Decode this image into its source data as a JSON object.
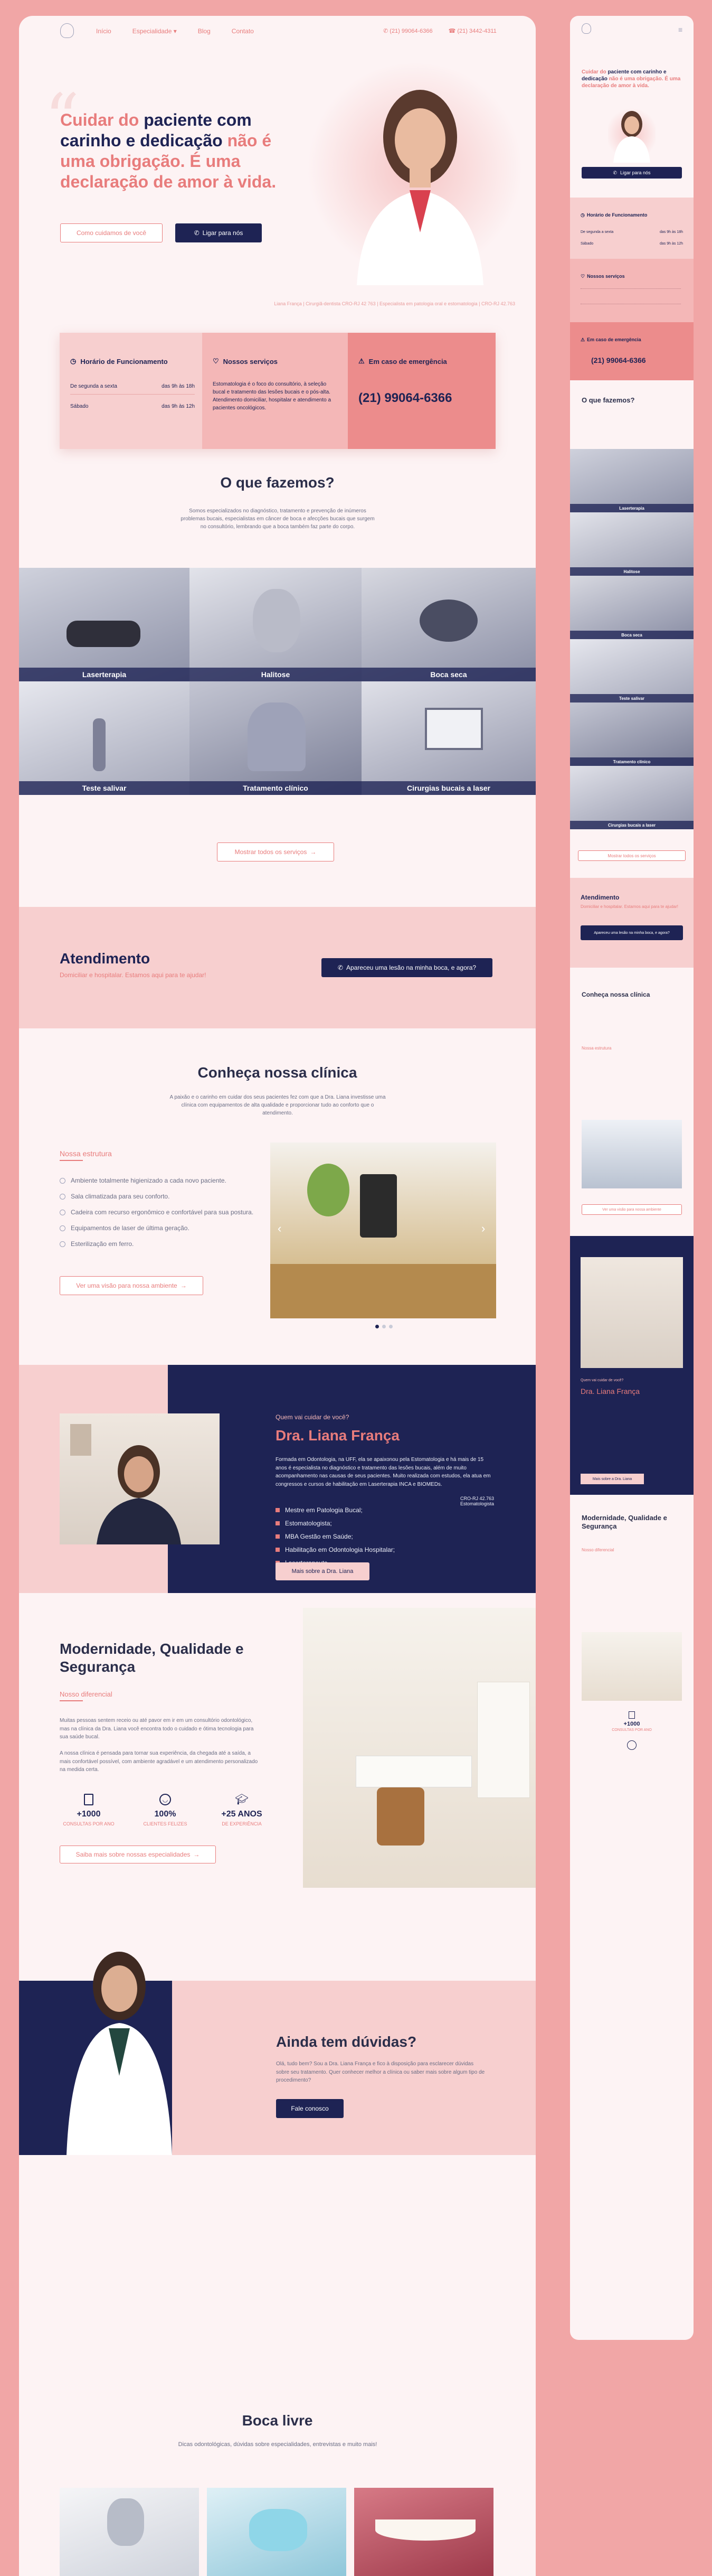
{
  "nav": {
    "links": [
      "Início",
      "Especialidade",
      "Blog",
      "Contato"
    ],
    "phone1": "(21) 99064-6366",
    "phone2": "(21) 3442-4311"
  },
  "hero": {
    "title_1": "Cuidar do ",
    "title_2": "paciente com carinho e dedicação",
    "title_3": " não é uma obrigação. É uma declaração de amor à vida.",
    "btn_outline": "Como cuidamos de você",
    "btn_primary": "Ligar para nós",
    "caption": "Liana França | Cirurgiã-dentista CRO-RJ 42 763 | Especialista em patologia oral e estomatologia | CRO-RJ 42.763"
  },
  "info": {
    "hours_title": "Horário de Funcionamento",
    "hours": [
      {
        "day": "De segunda a sexta",
        "time": "das 9h às 18h"
      },
      {
        "day": "Sábado",
        "time": "das 9h às 12h"
      }
    ],
    "services_title": "Nossos serviços",
    "services_text": "Estomatologia é o foco do consultório, à seleção bucal e tratamento das lesões bucais e o pós-alta. Atendimento domiciliar, hospitalar e atendimento a pacientes oncológicos.",
    "emergency_title": "Em caso de emergência",
    "emergency_phone": "(21) 99064-6366"
  },
  "what": {
    "title": "O que fazemos?",
    "text": "Somos especializados no diagnóstico, tratamento e prevenção de inúmeros problemas bucais, especialistas em câncer de boca e afecções bucais que surgem no consultório, lembrando que a boca também faz parte do corpo.",
    "services": [
      "Laserterapia",
      "Halitose",
      "Boca seca",
      "Teste salivar",
      "Tratamento clínico",
      "Cirurgias bucais a laser"
    ],
    "btn": "Mostrar todos os serviços"
  },
  "atend": {
    "title": "Atendimento",
    "sub": "Domiciliar e hospitalar. Estamos aqui para te ajudar!",
    "btn": "Apareceu uma lesão na minha boca, e agora?"
  },
  "clinic": {
    "title": "Conheça nossa clínica",
    "text": "A paixão e o carinho em cuidar dos seus pacientes fez com que a Dra. Liana investisse uma clínica com equipamentos de alta qualidade e proporcionar tudo ao conforto que o atendimento.",
    "sub": "Nossa estrutura",
    "items": [
      "Ambiente totalmente higienizado a cada novo paciente.",
      "Sala climatizada para seu conforto.",
      "Cadeira com recurso ergonômico e confortável para sua postura.",
      "Equipamentos de laser de última geração.",
      "Esterilização em ferro."
    ],
    "btn": "Ver uma visão para nossa ambiente"
  },
  "doctor": {
    "eyebrow": "Quem vai cuidar de você?",
    "name": "Dra. Liana França",
    "bio": "Formada em Odontologia, na UFF, ela se apaixonou pela Estomatologia e há mais de 15 anos é especialista no diagnóstico e tratamento das lesões bucais, além de muito acompanhamento nas causas de seus pacientes. Muito realizada com estudos, ela atua em congressos e cursos de habilitação em Laserterapia INCA e BIOMEDs.",
    "cro": "CRO-RJ 42.763",
    "cro_role": "Estomatologista",
    "credentials": [
      "Mestre em Patologia Bucal;",
      "Estomatologista;",
      "MBA Gestão em Saúde;",
      "Habilitação em Odontologia Hospitalar;",
      "Laserterapeuta."
    ],
    "btn": "Mais sobre a Dra. Liana"
  },
  "quality": {
    "title": "Modernidade, Qualidade e Segurança",
    "sub": "Nosso diferencial",
    "p1": "Muitas pessoas sentem receio ou até pavor em ir em um consultório odontológico, mas na clínica da Dra. Liana você encontra todo o cuidado e ótima tecnologia para sua saúde bucal.",
    "p2": "A nossa clínica é pensada para tornar sua experiência, da chegada até a saída, a mais confortável possível, com ambiente agradável e um atendimento personalizado na medida certa.",
    "stats": [
      {
        "value": "+1000",
        "label": "CONSULTAS POR ANO",
        "icon": "clipboard-icon"
      },
      {
        "value": "100%",
        "label": "CLIENTES FELIZES",
        "icon": "smile-icon"
      },
      {
        "value": "+25 ANOS",
        "label": "DE EXPERIÊNCIA",
        "icon": "graduation-cap-icon"
      }
    ],
    "btn": "Saiba mais sobre nossas especialidades"
  },
  "doubts": {
    "title": "Ainda tem dúvidas?",
    "text": "Olá, tudo bem? Sou a Dra. Liana França e fico à disposição para esclarecer dúvidas sobre seu tratamento. Quer conhecer melhor a clínica ou saber mais sobre algum tipo de procedimento?",
    "btn": "Fale conosco"
  },
  "blog": {
    "title": "Boca livre",
    "sub": "Dicas odontológicas, dúvidas sobre especialidades, entrevistas e muito mais!"
  },
  "mobile": {
    "hero_title_1": "Cuidar do ",
    "hero_title_2": "paciente com carinho e dedicação",
    "hero_title_3": " não é uma obrigação. É uma declaração de amor à vida.",
    "hero_btn": "Ligar para nós",
    "hours_title": "Horário de Funcionamento",
    "hours": [
      {
        "day": "De segunda a sexta",
        "time": "das 9h às 18h"
      },
      {
        "day": "Sábado",
        "time": "das 9h às 12h"
      }
    ],
    "services_title": "Nossos serviços",
    "emergency_title": "Em caso de emergência",
    "emergency_phone": "(21) 99064-6366",
    "what_title": "O que fazemos?",
    "services": [
      "Laserterapia",
      "Halitose",
      "Boca seca",
      "Teste salivar",
      "Tratamento clínico",
      "Cirurgias bucais a laser"
    ],
    "what_btn": "Mostrar todos os serviços",
    "atend_title": "Atendimento",
    "atend_sub": "Domiciliar e hospitalar. Estamos aqui para te ajudar!",
    "atend_btn": "Apareceu uma lesão na minha boca, e agora?",
    "clinic_title": "Conheça nossa clínica",
    "clinic_sub": "Nossa estrutura",
    "clinic_btn": "Ver uma visão para nossa ambiente",
    "doc_eyebrow": "Quem vai cuidar de você?",
    "doc_name": "Dra. Liana França",
    "doc_btn": "Mais sobre a Dra. Liana",
    "quality_title": "Modernidade, Qualidade e Segurança",
    "quality_sub": "Nosso diferencial",
    "stat_value": "+1000",
    "stat_label": "CONSULTAS POR ANO"
  }
}
